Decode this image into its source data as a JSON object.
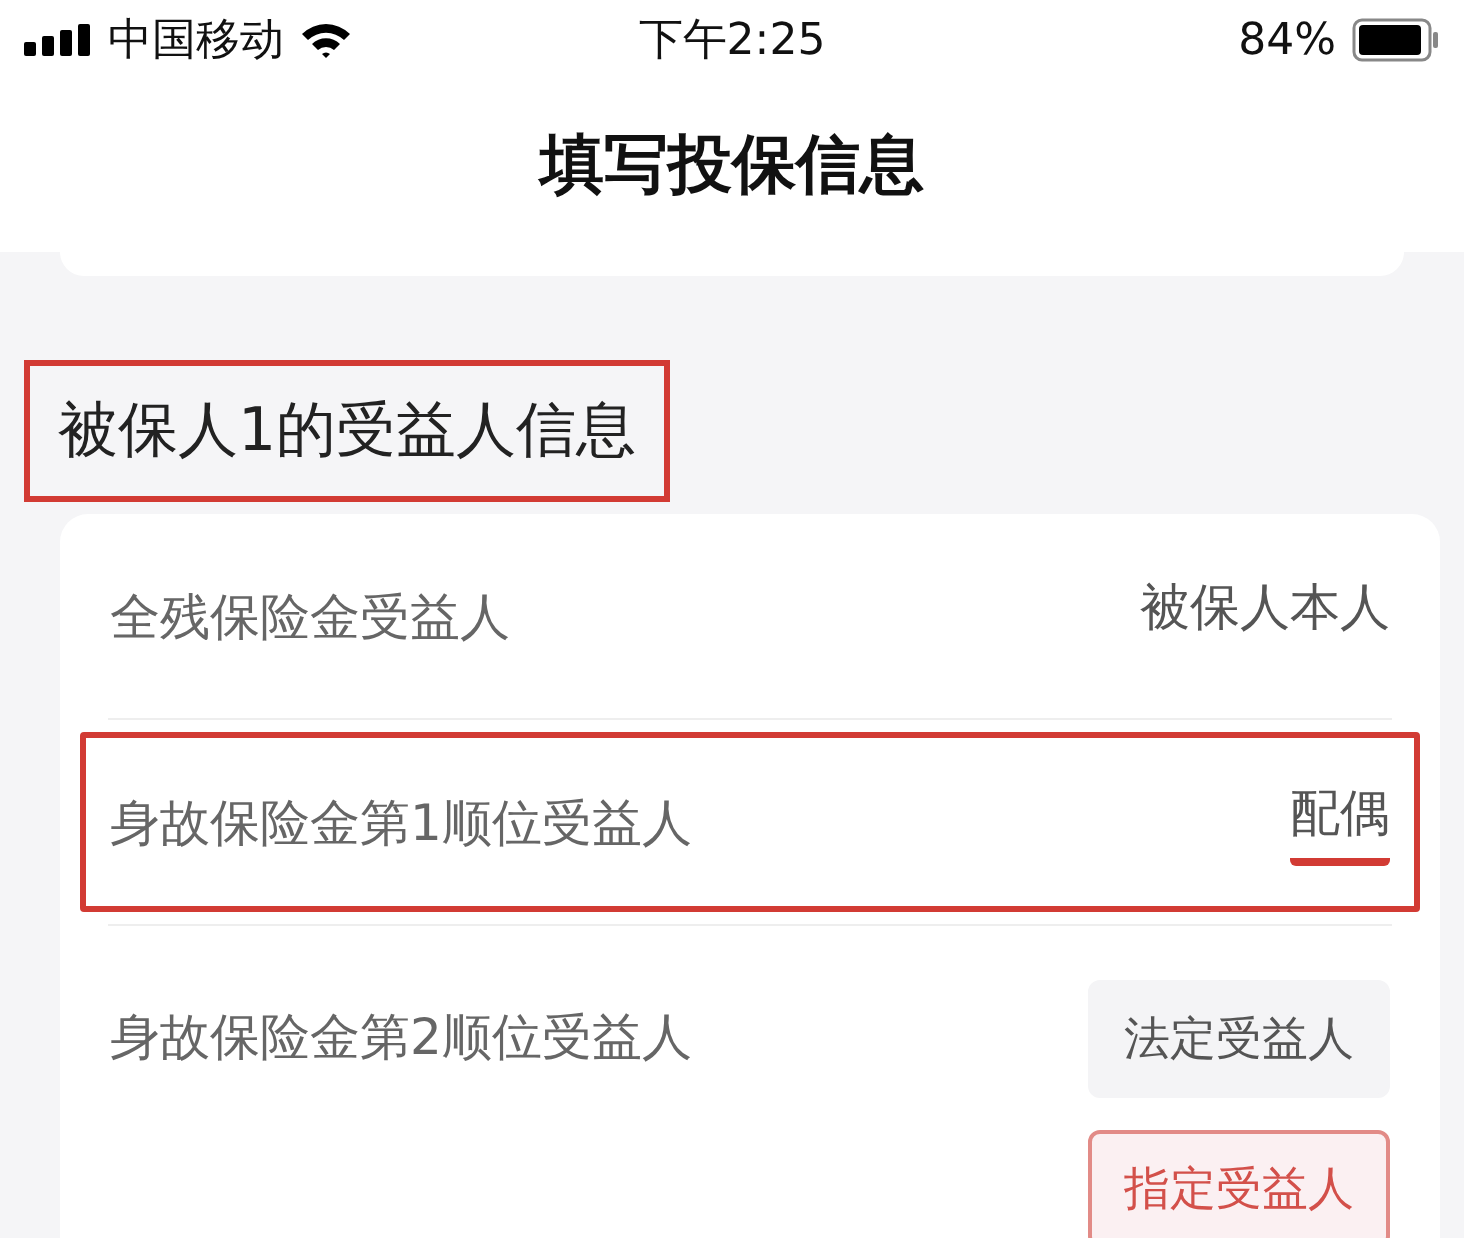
{
  "status_bar": {
    "carrier": "中国移动",
    "time": "下午2:25",
    "battery": "84%"
  },
  "header": {
    "title": "填写投保信息"
  },
  "section": {
    "title": "被保人1的受益人信息",
    "highlighted": true
  },
  "rows": [
    {
      "kind": "value",
      "label": "全残保险金受益人",
      "value": "被保人本人",
      "highlighted": false,
      "underlined": false
    },
    {
      "kind": "value",
      "label": "身故保险金第1顺位受益人",
      "value": "配偶",
      "highlighted": true,
      "underlined": true
    },
    {
      "kind": "options",
      "label": "身故保险金第2顺位受益人",
      "options": [
        {
          "label": "法定受益人",
          "selected": false
        },
        {
          "label": "指定受益人",
          "selected": true
        }
      ]
    }
  ]
}
